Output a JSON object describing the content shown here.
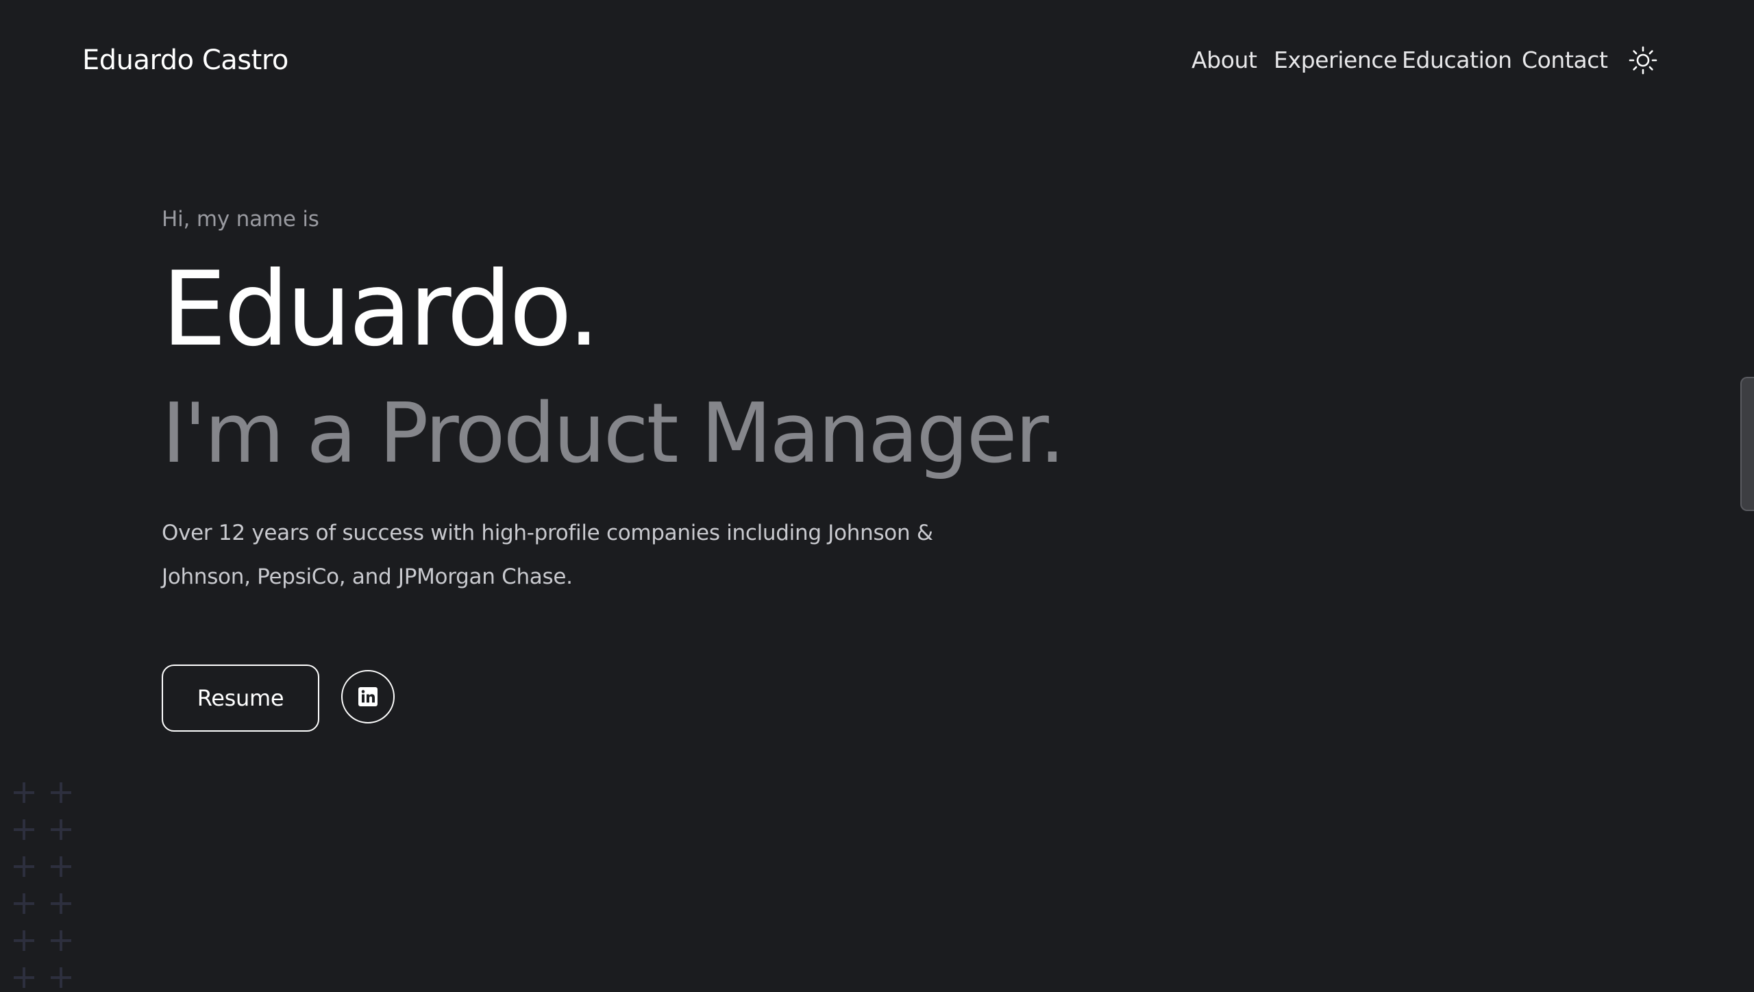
{
  "header": {
    "brand": "Eduardo Castro",
    "nav": {
      "about": "About",
      "experience": "Experience",
      "education": "Education",
      "contact": "Contact"
    },
    "theme_toggle_icon": "sun-icon"
  },
  "hero": {
    "greeting": "Hi, my name is",
    "name": "Eduardo.",
    "role": "I'm a Product Manager.",
    "summary": "Over 12 years of success with high-profile companies including Johnson & Johnson, PepsiCo, and JPMorgan Chase.",
    "resume_label": "Resume",
    "linkedin_icon": "linkedin-icon"
  },
  "colors": {
    "background": "#1b1c1f",
    "text_primary": "#ffffff",
    "text_muted": "#85868b",
    "decor_plus": "#2d2f3e"
  }
}
